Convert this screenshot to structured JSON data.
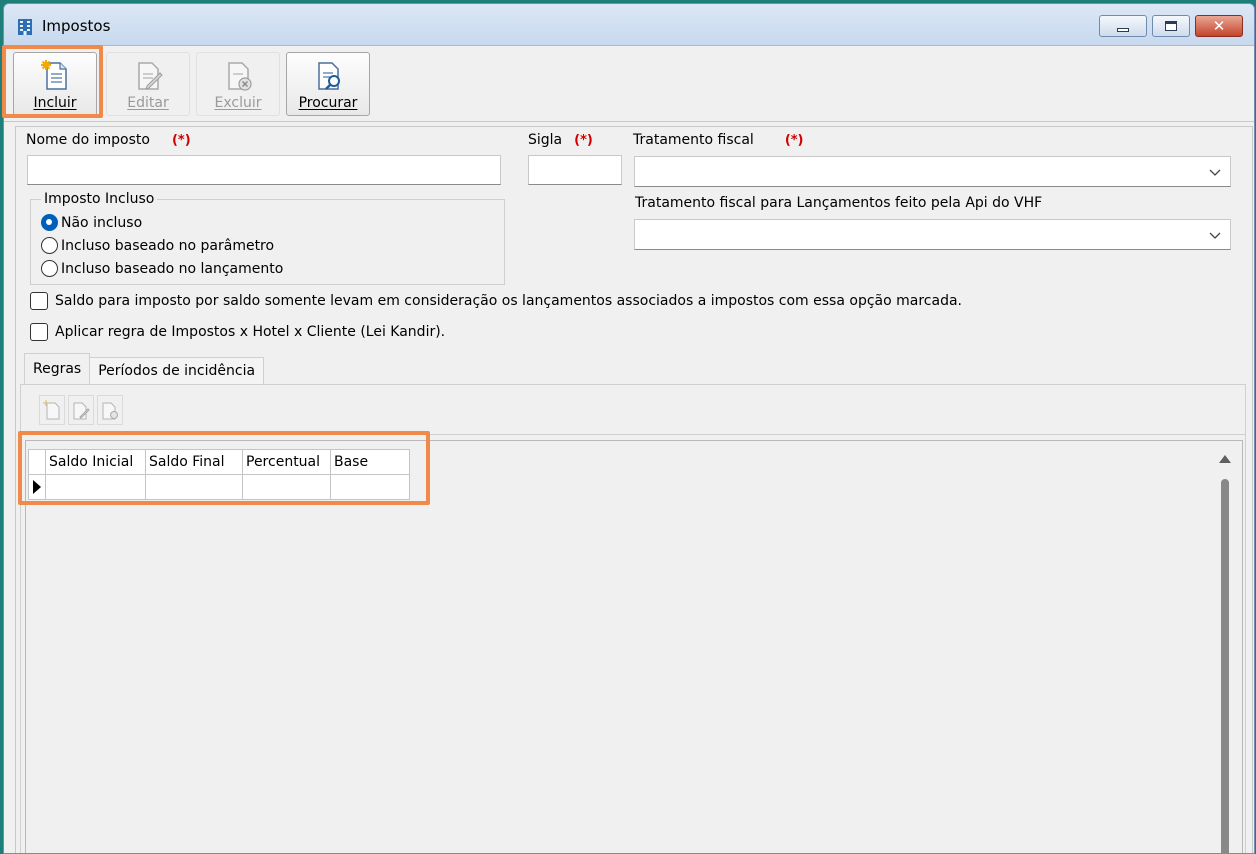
{
  "window": {
    "title": "Impostos"
  },
  "toolbar": {
    "buttons": [
      {
        "label": "Incluir",
        "icon": "new-document-icon",
        "enabled": true
      },
      {
        "label": "Editar",
        "icon": "edit-document-icon",
        "enabled": false
      },
      {
        "label": "Excluir",
        "icon": "delete-document-icon",
        "enabled": false
      },
      {
        "label": "Procurar",
        "icon": "search-document-icon",
        "enabled": true
      }
    ]
  },
  "form": {
    "nome": {
      "label": "Nome do imposto",
      "required": "(*)",
      "value": ""
    },
    "sigla": {
      "label": "Sigla",
      "required": "(*)",
      "value": ""
    },
    "tratamento": {
      "label": "Tratamento fiscal",
      "required": "(*)",
      "value": ""
    },
    "tratamento_api": {
      "label": "Tratamento fiscal para Lançamentos feito pela Api do VHF",
      "value": ""
    },
    "imposto_incluso": {
      "legend": "Imposto Incluso",
      "options": [
        {
          "label": "Não incluso",
          "checked": true
        },
        {
          "label": "Incluso baseado no parâmetro",
          "checked": false
        },
        {
          "label": "Incluso baseado no lançamento",
          "checked": false
        }
      ]
    },
    "checkboxes": [
      {
        "label": "Saldo para imposto por saldo somente levam em consideração os lançamentos associados a impostos com essa opção marcada.",
        "checked": false
      },
      {
        "label": "Aplicar regra de Impostos x Hotel x Cliente (Lei Kandir).",
        "checked": false
      }
    ]
  },
  "tabs": [
    {
      "label": "Regras",
      "active": true
    },
    {
      "label": "Períodos de incidência",
      "active": false
    }
  ],
  "grid": {
    "columns": [
      "Saldo Inicial",
      "Saldo Final",
      "Percentual",
      "Base"
    ],
    "rows": [
      [
        "",
        "",
        "",
        ""
      ]
    ]
  },
  "colors": {
    "highlight": "#f08a4b",
    "required": "#d10000",
    "radio_checked": "#005fb8"
  }
}
